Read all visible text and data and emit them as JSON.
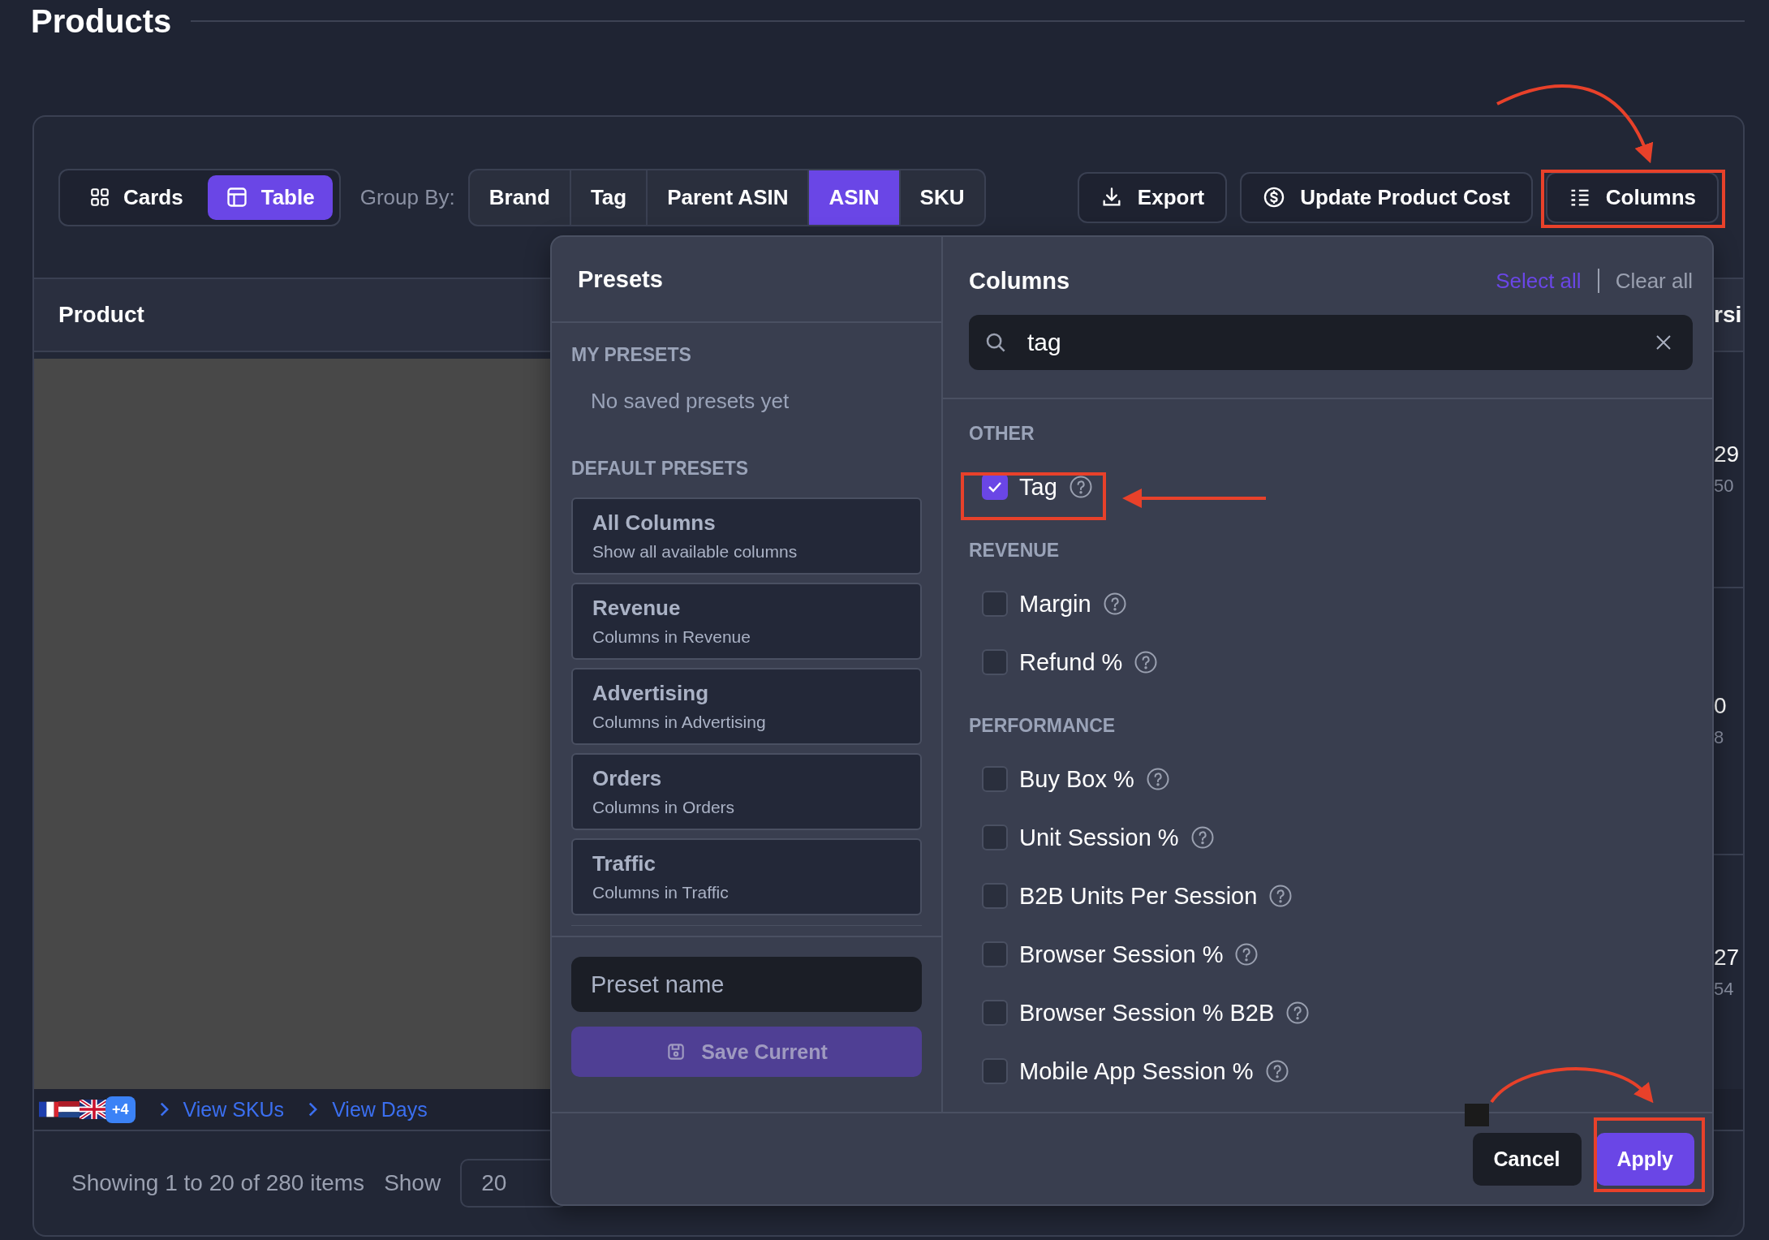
{
  "page": {
    "title": "Products"
  },
  "view_toggle": [
    {
      "label": "Cards",
      "kind": "cards",
      "selected": false
    },
    {
      "label": "Table",
      "kind": "table",
      "selected": true
    }
  ],
  "group_by": {
    "label": "Group By:",
    "options": [
      {
        "label": "Brand",
        "selected": false
      },
      {
        "label": "Tag",
        "selected": false
      },
      {
        "label": "Parent ASIN",
        "selected": false
      },
      {
        "label": "ASIN",
        "selected": true
      },
      {
        "label": "SKU",
        "selected": false
      }
    ]
  },
  "actions": [
    {
      "label": "Export",
      "kind": "export"
    },
    {
      "label": "Update Product Cost",
      "kind": "cost"
    },
    {
      "label": "Columns",
      "kind": "columns"
    }
  ],
  "table": {
    "columns": [
      {
        "label": "Product"
      },
      {
        "label": "rsi"
      }
    ],
    "rows": [
      {
        "values": [
          "29",
          "50"
        ]
      },
      {
        "values": [
          "0",
          "8"
        ]
      },
      {
        "values": [
          "27",
          "54"
        ]
      }
    ]
  },
  "marketplaces": {
    "extra": "+4",
    "links": [
      "View SKUs",
      "View Days"
    ]
  },
  "footer": {
    "summary": "Showing 1 to 20 of 280 items",
    "show_label": "Show",
    "page_size": "20"
  },
  "presets": {
    "title": "Presets",
    "my_label": "MY PRESETS",
    "empty_text": "No saved presets yet",
    "default_label": "DEFAULT PRESETS",
    "items": [
      {
        "name": "All Columns",
        "description": "Show all available columns"
      },
      {
        "name": "Revenue",
        "description": "Columns in Revenue"
      },
      {
        "name": "Advertising",
        "description": "Columns in Advertising"
      },
      {
        "name": "Orders",
        "description": "Columns in Orders"
      },
      {
        "name": "Traffic",
        "description": "Columns in Traffic"
      }
    ],
    "name_placeholder": "Preset name",
    "save_label": "Save Current",
    "save_disabled": true
  },
  "columns_panel": {
    "title": "Columns",
    "select_all": "Select all",
    "clear_all": "Clear all",
    "search_value": "tag",
    "groups": [
      {
        "label": "OTHER",
        "items": [
          {
            "label": "Tag",
            "checked": true
          }
        ]
      },
      {
        "label": "REVENUE",
        "items": [
          {
            "label": "Margin",
            "checked": false
          },
          {
            "label": "Refund %",
            "checked": false
          }
        ]
      },
      {
        "label": "PERFORMANCE",
        "items": [
          {
            "label": "Buy Box %",
            "checked": false
          },
          {
            "label": "Unit Session %",
            "checked": false
          },
          {
            "label": "B2B Units Per Session",
            "checked": false
          },
          {
            "label": "Browser Session %",
            "checked": false
          },
          {
            "label": "Browser Session % B2B",
            "checked": false
          },
          {
            "label": "Mobile App Session %",
            "checked": false
          }
        ]
      }
    ]
  },
  "dialog_buttons": {
    "cancel": "Cancel",
    "apply": "Apply"
  }
}
